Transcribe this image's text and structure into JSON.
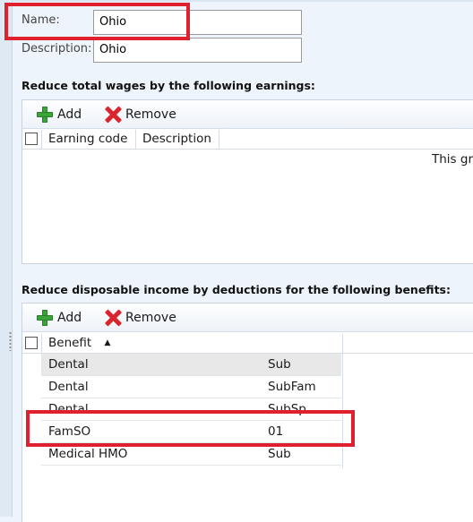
{
  "form": {
    "name_label": "Name:",
    "name_value": "Ohio",
    "description_label": "Description:",
    "description_value": "Ohio"
  },
  "earnings_section": {
    "title": "Reduce total wages by the following earnings:",
    "add_label": "Add",
    "remove_label": "Remove",
    "columns": [
      "Earning code",
      "Description"
    ],
    "empty_message": "This gri"
  },
  "benefits_section": {
    "title": "Reduce disposable income by deductions for the following benefits:",
    "add_label": "Add",
    "remove_label": "Remove",
    "column_benefit": "Benefit",
    "sort_indicator": "▲",
    "rows": [
      {
        "benefit": "Dental",
        "code": "Sub"
      },
      {
        "benefit": "Dental",
        "code": "SubFam"
      },
      {
        "benefit": "Dental",
        "code": "SubSp"
      },
      {
        "benefit": "FamSO",
        "code": "01"
      },
      {
        "benefit": "Medical HMO",
        "code": "Sub"
      }
    ]
  },
  "highlight_color": "#e0202e"
}
